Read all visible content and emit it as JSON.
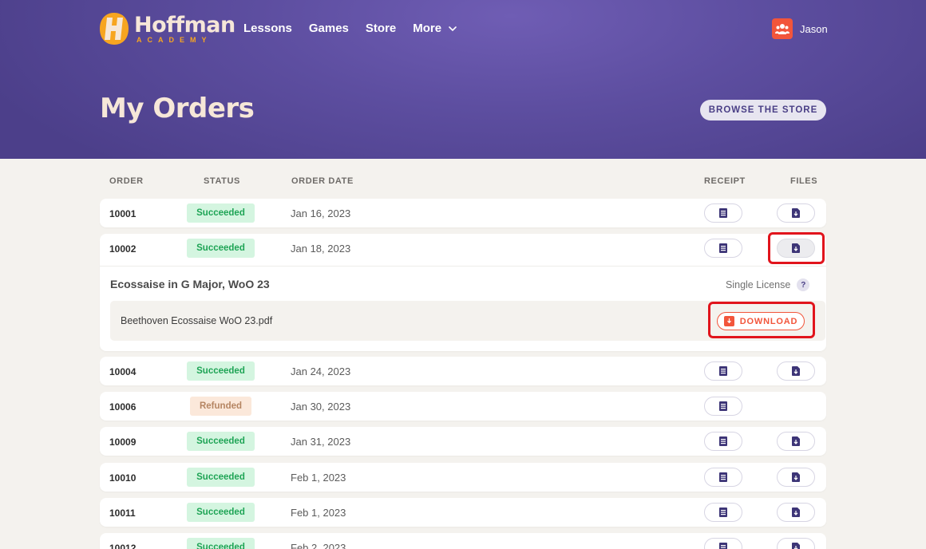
{
  "brand": {
    "name": "Hoffman",
    "sub": "ACADEMY"
  },
  "nav": {
    "items": [
      "Lessons",
      "Games",
      "Store",
      "More"
    ]
  },
  "user": {
    "name": "Jason"
  },
  "page": {
    "title": "My Orders",
    "browse_label": "BROWSE THE STORE"
  },
  "table": {
    "headers": {
      "order": "ORDER",
      "status": "STATUS",
      "date": "ORDER DATE",
      "receipt": "RECEIPT",
      "files": "FILES"
    },
    "rows": [
      {
        "order": "10001",
        "status": "Succeeded",
        "date": "Jan 16, 2023",
        "has_files": true
      },
      {
        "order": "10002",
        "status": "Succeeded",
        "date": "Jan 18, 2023",
        "has_files": true,
        "expanded": true
      },
      {
        "order": "10004",
        "status": "Succeeded",
        "date": "Jan 24, 2023",
        "has_files": true
      },
      {
        "order": "10006",
        "status": "Refunded",
        "date": "Jan 30, 2023",
        "has_files": false
      },
      {
        "order": "10009",
        "status": "Succeeded",
        "date": "Jan 31, 2023",
        "has_files": true
      },
      {
        "order": "10010",
        "status": "Succeeded",
        "date": "Feb 1, 2023",
        "has_files": true
      },
      {
        "order": "10011",
        "status": "Succeeded",
        "date": "Feb 1, 2023",
        "has_files": true
      },
      {
        "order": "10012",
        "status": "Succeeded",
        "date": "Feb 2, 2023",
        "has_files": true
      }
    ]
  },
  "expanded_detail": {
    "product": "Ecossaise in G Major, WoO 23",
    "license": "Single License",
    "help": "?",
    "file_name": "Beethoven Ecossaise WoO 23.pdf",
    "download_label": "DOWNLOAD"
  },
  "colors": {
    "hero": "#5d4ea0",
    "accent": "#f2553b",
    "success_bg": "#d4f5e0",
    "success_text": "#1ea455",
    "refund_bg": "#fbe8da",
    "highlight": "#e1141c"
  },
  "icons": {
    "receipt": "receipt-icon",
    "files": "file-download-icon",
    "more": "chevron-down-icon",
    "user": "users-icon"
  }
}
